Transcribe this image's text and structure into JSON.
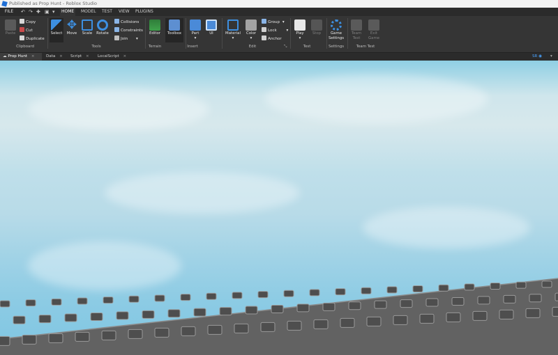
{
  "window": {
    "title": "Published as Prop Hunt - Roblox Studio"
  },
  "menu": {
    "file": "FILE",
    "tabs": [
      "HOME",
      "MODEL",
      "TEST",
      "VIEW",
      "PLUGINS"
    ],
    "active_tab": "HOME"
  },
  "ribbon": {
    "clipboard": {
      "paste": "Paste",
      "copy": "Copy",
      "cut": "Cut",
      "duplicate": "Duplicate",
      "group": "Clipboard"
    },
    "tools": {
      "select": "Select",
      "move": "Move",
      "scale": "Scale",
      "rotate": "Rotate",
      "collisions": "Collisions",
      "constraints": "Constraints",
      "join": "Join",
      "group": "Tools"
    },
    "terrain": {
      "editor": "Editor",
      "toolbox": "Toolbox",
      "group": "Terrain"
    },
    "insert": {
      "part": "Part",
      "ui": "UI",
      "group": "Insert"
    },
    "edit": {
      "material": "Material",
      "color": "Color",
      "group_btn": "Group",
      "lock": "Lock",
      "anchor": "Anchor",
      "group": "Edit"
    },
    "test": {
      "play": "Play",
      "stop": "Stop",
      "group": "Test"
    },
    "settings": {
      "game_settings_1": "Game",
      "game_settings_2": "Settings",
      "group": "Settings"
    },
    "team_test": {
      "team_test_1": "Team",
      "team_test_2": "Test",
      "exit_game_1": "Exit",
      "exit_game_2": "Game",
      "group": "Team Test"
    }
  },
  "doc_tabs": [
    {
      "label": "Prop Hunt",
      "active": true
    },
    {
      "label": "Data",
      "active": false
    },
    {
      "label": "Script",
      "active": false
    },
    {
      "label": "LocalScript",
      "active": false
    }
  ],
  "viewport_badge": "SR",
  "colors": {
    "accent": "#1f6fd6",
    "ribbon_bg": "#353535",
    "menu_bg": "#2b2b2b",
    "sky_top": "#8fcfe4",
    "baseplate": "#6b6b6b"
  }
}
